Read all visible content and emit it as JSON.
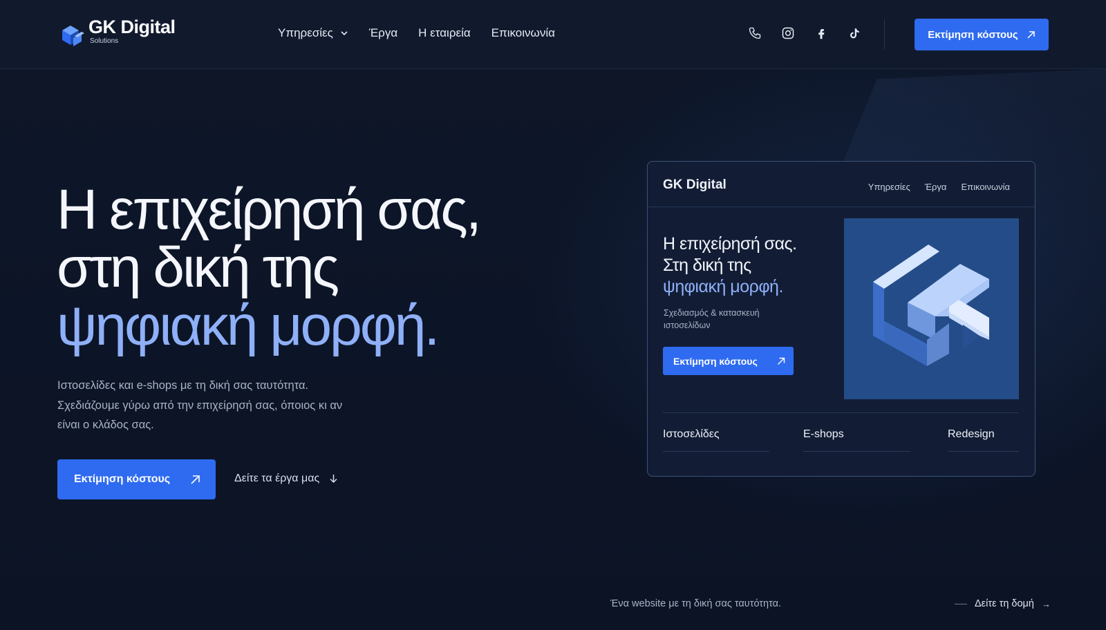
{
  "brand": {
    "name": "GK Digital",
    "tagline": "Solutions"
  },
  "nav": {
    "links": [
      "Υπηρεσίες",
      "Έργα",
      "Η εταιρεία",
      "Επικοινωνία"
    ],
    "icons": [
      "phone-icon",
      "instagram-icon",
      "facebook-icon",
      "tiktok-icon"
    ],
    "cta_label": "Εκτίμηση κόστους"
  },
  "hero": {
    "title_line1": "Η επιχείρησή σας,",
    "title_line2": "στη δική της",
    "title_accent": "ψηφιακή μορφή.",
    "subtitle": "Ιστοσελίδες και e-shops με τη δική σας ταυτότητα. Σχεδιάζουμε γύρω από την επιχείρησή σας, όποιος κι αν είναι ο κλάδος σας.",
    "cta_label": "Εκτίμηση κόστους",
    "secondary_label": "Δείτε τα έργα μας"
  },
  "mockup": {
    "brand": "GK Digital",
    "nav": [
      "Υπηρεσίες",
      "Έργα",
      "Επικοινωνία"
    ],
    "title_line1": "Η επιχείρησή σας.",
    "title_line2": "Στη δική της",
    "title_accent": "ψηφιακή μορφή.",
    "subtitle": "Σχεδιασμός & κατασκευή ιστοσελίδων",
    "cta_label": "Εκτίμηση κόστους",
    "tabs": [
      "Ιστοσελίδες",
      "E-shops",
      "Redesign"
    ]
  },
  "footer_strip": {
    "caption": "Ένα website με τη δική σας ταυτότητα.",
    "link_label": "Δείτε τη δομή",
    "link_arrow": "→"
  },
  "colors": {
    "accent": "#2f6bf0",
    "accent_text": "#8fb0f8",
    "background": "#0c1427"
  }
}
